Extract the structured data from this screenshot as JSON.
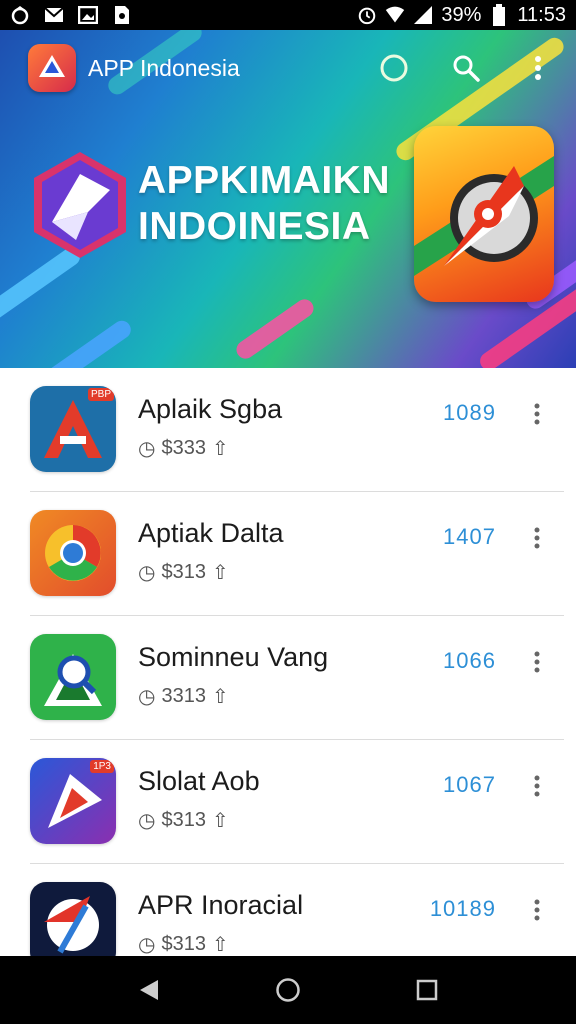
{
  "status_bar": {
    "battery": "39%",
    "time": "11:53",
    "icons": [
      "notification-icon",
      "mail-icon",
      "image-icon",
      "sim-icon",
      "alarm-icon",
      "wifi-icon",
      "signal-icon",
      "battery-icon"
    ]
  },
  "header": {
    "app_title": "APP Indonesia",
    "hero_title_line1": "APPKIMAIKN",
    "hero_title_line2": "INDOINESIA",
    "actions": [
      "loading-icon",
      "search-icon",
      "more-icon"
    ]
  },
  "apps": [
    {
      "name": "Aplaik Sgba",
      "meta": "$333",
      "code": "1089",
      "badge": "PBP",
      "icon_colors": [
        "#1e6fa8",
        "#e23b2a"
      ]
    },
    {
      "name": "Aptiak Dalta",
      "meta": "$313",
      "code": "1407",
      "icon_colors": [
        "#f08a24",
        "#2e7bd6"
      ]
    },
    {
      "name": "Sominneu Vang",
      "meta": "3313",
      "code": "1066",
      "icon_colors": [
        "#2fb24a",
        "#1a7a2e"
      ]
    },
    {
      "name": "Slolat Aob",
      "meta": "$313",
      "code": "1067",
      "badge": "1P3",
      "icon_colors": [
        "#2a58d8",
        "#8b2fb0"
      ]
    },
    {
      "name": "APR Inoracial",
      "meta": "$313",
      "code": "10189",
      "icon_colors": [
        "#0f1a3c",
        "#e2342a"
      ]
    }
  ],
  "nav": [
    "back-icon",
    "home-icon",
    "recents-icon"
  ]
}
